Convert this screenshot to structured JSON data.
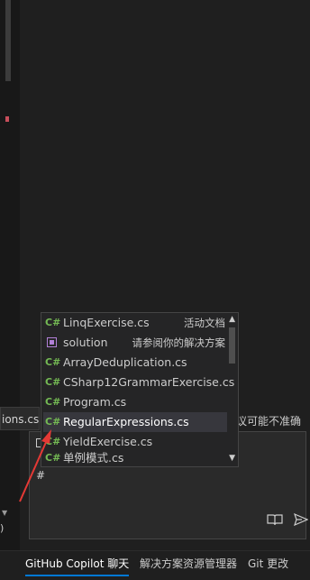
{
  "editor": {
    "file_tab_label": "ions.cs",
    "left_paren": ")",
    "left_close": "x"
  },
  "chat": {
    "hint_text": "议可能不准确",
    "input_text": "#"
  },
  "dropdown": {
    "items": [
      {
        "icon": "C#",
        "name": "LinqExercise.cs",
        "detail": "活动文档"
      },
      {
        "icon": "solution-icon",
        "name": "solution",
        "detail": "请参阅你的解决方案"
      },
      {
        "icon": "C#",
        "name": "ArrayDeduplication.cs",
        "detail": ""
      },
      {
        "icon": "C#",
        "name": "CSharp12GrammarExercise.cs",
        "detail": ""
      },
      {
        "icon": "C#",
        "name": "Program.cs",
        "detail": ""
      },
      {
        "icon": "C#",
        "name": "RegularExpressions.cs",
        "detail": ""
      },
      {
        "icon": "C#",
        "name": "YieldExercise.cs",
        "detail": ""
      },
      {
        "icon": "C#",
        "name": "单例模式.cs",
        "detail": ""
      }
    ],
    "selected_index": 5
  },
  "bottom_tabs": [
    {
      "label": "GitHub Copilot 聊天",
      "active": true
    },
    {
      "label": "解决方案资源管理器",
      "active": false
    },
    {
      "label": "Git 更改",
      "active": false
    }
  ],
  "colors": {
    "csharp_icon": "#74b954",
    "annotation_arrow": "#e53935",
    "selection": "#37373d"
  }
}
